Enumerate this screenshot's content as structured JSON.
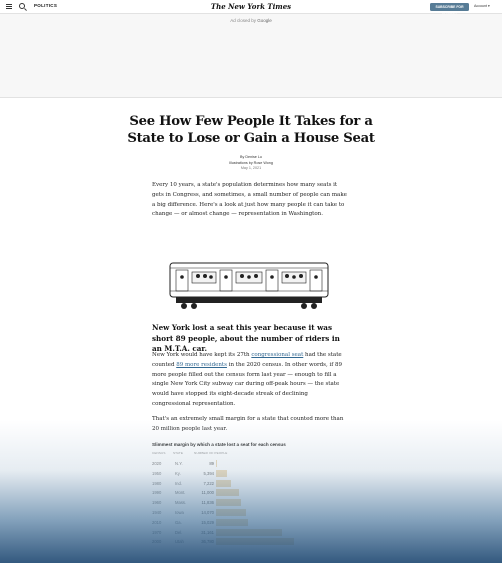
{
  "header": {
    "section": "POLITICS",
    "masthead": "The New York Times",
    "subscribe_label": "SUBSCRIBE FOR $1/WEEK",
    "account_label": "Account"
  },
  "ad": {
    "label_prefix": "Ad closed by",
    "label_brand": "Google"
  },
  "article": {
    "headline": "See How Few People It Takes for a State to Lose or Gain a House Seat",
    "byline": "By Denise Lu",
    "illustrations": "Illustrations by Rose Wong",
    "date": "May 1, 2021",
    "intro": "Every 10 years, a state's population determines how many seats it gets in Congress, and sometimes, a small number of people can make a big difference. Here's a look at just how many people it can take to change — or almost change — representation in Washington.",
    "subhead": "New York lost a seat this year because it was short 89 people, about the number of riders in an M.T.A. car.",
    "p2_before": "New York would have kept its 27th",
    "p2_link1": "congressional seat",
    "p2_mid1": "had the state counted",
    "p2_link2": "89 more residents",
    "p2_after": "in the 2020 census. In other words, if 89 more people filled out the census form last year — enough to fill a single New York City subway car during off-peak hours — the state would have stopped its eight-decade streak of declining congressional representation.",
    "p3": "That's an extremely small margin for a state that counted more than 20 million people last year."
  },
  "table": {
    "title": "Slimmest margin by which a state lost a seat for each census",
    "col_census": "CENSUS",
    "col_state": "STATE",
    "col_people": "NUMBER OF PEOPLE",
    "rows": [
      {
        "census": "2020",
        "state": "N.Y.",
        "people": "89",
        "value": 89
      },
      {
        "census": "1950",
        "state": "Ky.",
        "people": "5,394",
        "value": 5394
      },
      {
        "census": "1980",
        "state": "Ind.",
        "people": "7,222",
        "value": 7222
      },
      {
        "census": "1990",
        "state": "Mont.",
        "people": "11,000",
        "value": 11000
      },
      {
        "census": "1960",
        "state": "Mass.",
        "people": "11,836",
        "value": 11836
      },
      {
        "census": "1940",
        "state": "Iowa",
        "people": "14,070",
        "value": 14070
      },
      {
        "census": "2010",
        "state": "Ga.",
        "people": "15,029",
        "value": 15029
      },
      {
        "census": "1970",
        "state": "Del.",
        "people": "31,161",
        "value": 31161
      },
      {
        "census": "2000",
        "state": "Utah",
        "people": "36,780",
        "value": 36780
      }
    ]
  },
  "colors": {
    "subscribe": "#567b95",
    "link": "#326891",
    "bar": "#e8cfa1"
  }
}
